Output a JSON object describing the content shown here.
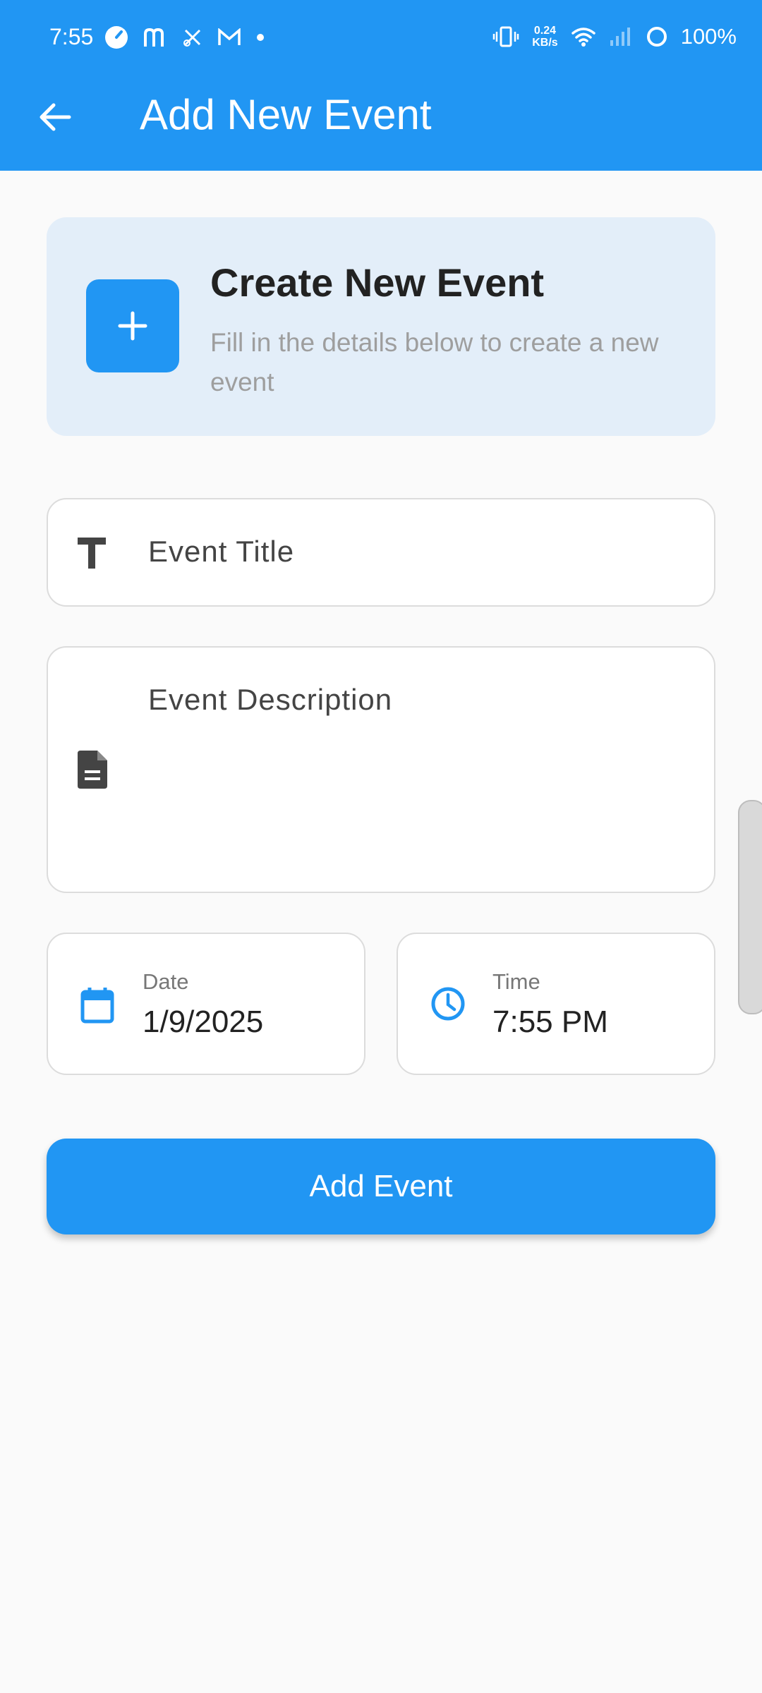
{
  "status_bar": {
    "time": "7:55",
    "net_speed_value": "0.24",
    "net_speed_unit": "KB/s",
    "battery": "100%"
  },
  "app_bar": {
    "title": "Add New Event"
  },
  "info_card": {
    "title": "Create New Event",
    "subtitle": "Fill in the details below to create a new event"
  },
  "form": {
    "title_placeholder": "Event Title",
    "description_placeholder": "Event Description",
    "date_label": "Date",
    "date_value": "1/9/2025",
    "time_label": "Time",
    "time_value": "7:55 PM"
  },
  "actions": {
    "add_event_label": "Add Event"
  },
  "colors": {
    "primary": "#2196f3",
    "info_bg": "#e3eef9",
    "background": "#fafafa"
  },
  "icons": {
    "back": "arrow-back-icon",
    "plus": "plus-icon",
    "title_field": "text-t-icon",
    "description_field": "document-icon",
    "date_field": "calendar-icon",
    "time_field": "clock-icon"
  }
}
